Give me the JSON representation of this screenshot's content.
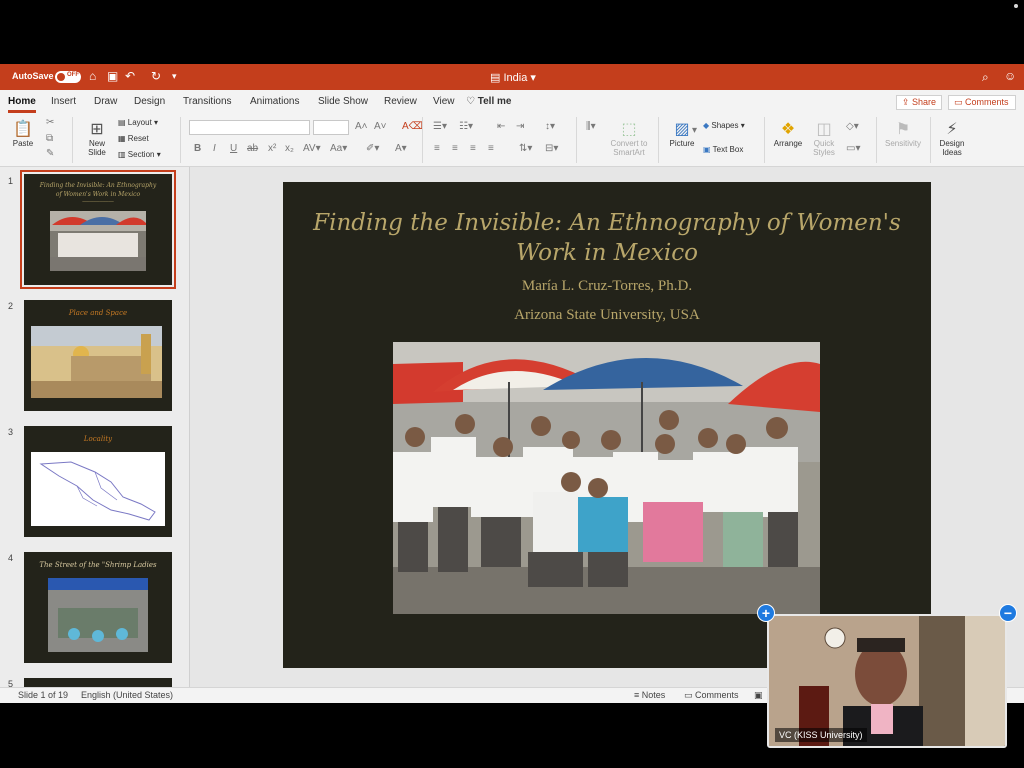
{
  "titlebar": {
    "autosave_label": "AutoSave",
    "autosave_state": "OFF",
    "doc_title": "India",
    "accent": "#c43e1c"
  },
  "ribbon": {
    "tabs": [
      "Home",
      "Insert",
      "Draw",
      "Design",
      "Transitions",
      "Animations",
      "Slide Show",
      "Review",
      "View"
    ],
    "tell_me": "Tell me",
    "share": "Share",
    "comments": "Comments",
    "paste": "Paste",
    "new_slide_1": "New",
    "new_slide_2": "Slide",
    "layout": "Layout",
    "reset": "Reset",
    "section": "Section",
    "convert_1": "Convert to",
    "convert_2": "SmartArt",
    "picture": "Picture",
    "shapes": "Shapes",
    "text_box": "Text Box",
    "arrange": "Arrange",
    "quick_styles_1": "Quick",
    "quick_styles_2": "Styles",
    "sensitivity": "Sensitivity",
    "design_ideas_1": "Design",
    "design_ideas_2": "Ideas"
  },
  "thumbnails": [
    {
      "num": "1",
      "title": "Finding the Invisible: An Ethnography of Women's Work in Mexico"
    },
    {
      "num": "2",
      "title": "Place and Space"
    },
    {
      "num": "3",
      "title": "Locality"
    },
    {
      "num": "4",
      "title": "The Street of the \"Shrimp Ladies"
    },
    {
      "num": "5"
    }
  ],
  "slide": {
    "title": "Finding the Invisible: An Ethnography of Women's Work in Mexico",
    "author": "María L. Cruz-Torres, Ph.D.",
    "affiliation": "Arizona State University, USA"
  },
  "statusbar": {
    "slide_count": "Slide 1 of 19",
    "language": "English (United States)",
    "notes": "Notes",
    "comments": "Comments"
  },
  "video": {
    "label": "VC (KISS University)"
  }
}
